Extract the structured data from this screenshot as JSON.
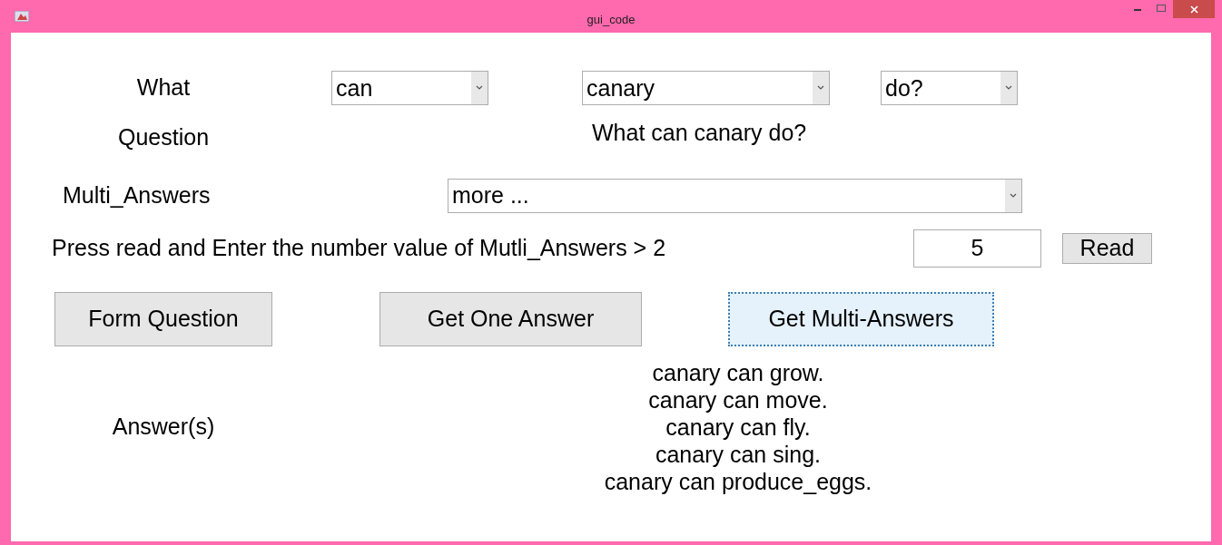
{
  "window": {
    "title": "gui_code"
  },
  "what_label": "What",
  "selectors": [
    {
      "value": "can"
    },
    {
      "value": "canary"
    },
    {
      "value": "do?"
    }
  ],
  "question_label": "Question",
  "question_text": "What can canary do?",
  "multi_label": "Multi_Answers",
  "multi_select": {
    "value": "more ..."
  },
  "instruction": "Press read and Enter the number value of Mutli_Answers > 2",
  "number_field": {
    "value": "5"
  },
  "read_button": "Read",
  "buttons": [
    {
      "label": "Form Question",
      "focused": false
    },
    {
      "label": "Get One Answer",
      "focused": false
    },
    {
      "label": "Get Multi-Answers",
      "focused": true
    }
  ],
  "answers_label": "Answer(s)",
  "answers": [
    "canary can grow.",
    "canary can move.",
    "canary can fly.",
    "canary can sing.",
    "canary can produce_eggs."
  ]
}
